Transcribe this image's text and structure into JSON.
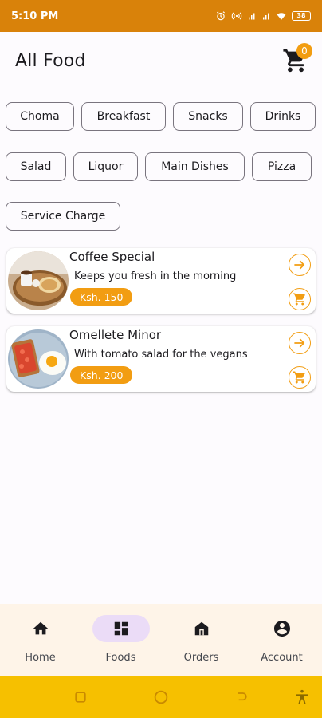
{
  "status_bar": {
    "time": "5:10 PM",
    "battery": "38"
  },
  "header": {
    "title": "All Food",
    "cart_count": "0"
  },
  "categories": [
    "Choma",
    "Breakfast",
    "Snacks",
    "Drinks",
    "Salad",
    "Liquor",
    "Main Dishes",
    "Pizza",
    "Service Charge"
  ],
  "foods": [
    {
      "name": "Coffee Special",
      "description": "Keeps you fresh in the morning",
      "price": "Ksh. 150"
    },
    {
      "name": "Omellete Minor",
      "description": "With tomato salad for the vegans",
      "price": "Ksh. 200"
    }
  ],
  "bottom_nav": {
    "items": [
      {
        "label": "Home",
        "icon": "home-icon"
      },
      {
        "label": "Foods",
        "icon": "dashboard-icon",
        "active": true
      },
      {
        "label": "Orders",
        "icon": "store-icon"
      },
      {
        "label": "Account",
        "icon": "account-circle-icon"
      }
    ]
  },
  "colors": {
    "status_bar": "#d9820a",
    "accent": "#f29d12",
    "nav_bg": "#fef4e8",
    "active_pill": "#ebdcf7",
    "system_nav": "#f6c000"
  }
}
